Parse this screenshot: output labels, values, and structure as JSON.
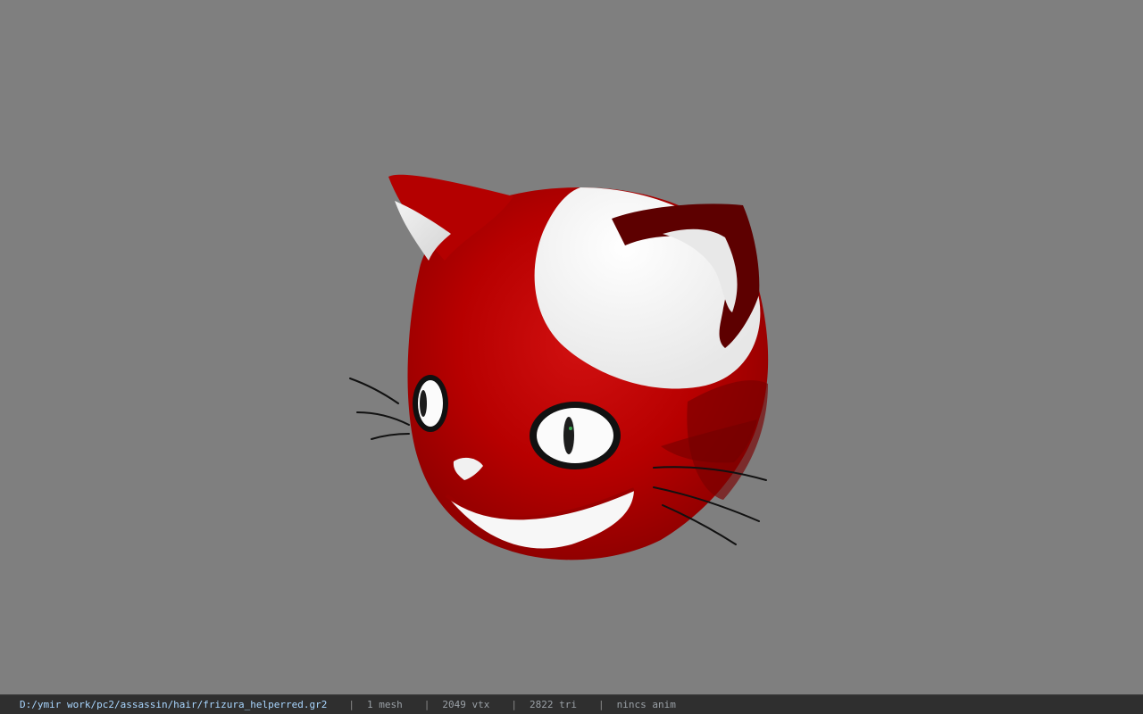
{
  "viewer": {
    "background_color": "#808080",
    "model_name": "cat-head-model"
  },
  "status": {
    "file_path": "D:/ymir work/pc2/assassin/hair/frizura_helperred.gr2",
    "separator": "|",
    "mesh_count": "1 mesh",
    "vertex_count": "2049 vtx",
    "triangle_count": "2822 tri",
    "animation": "nincs anim"
  }
}
